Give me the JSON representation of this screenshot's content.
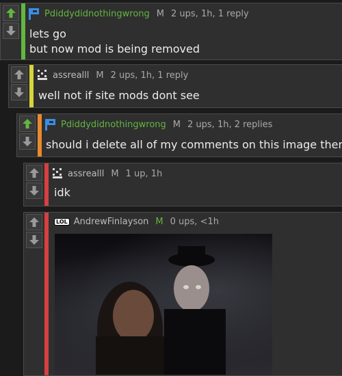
{
  "comments": [
    {
      "user": "Pdiddydidnothingwrong",
      "mod": "M",
      "meta": "2 ups, 1h, 1 reply",
      "lines": [
        "lets go",
        "but now mod is being removed"
      ],
      "bar_color": "#63b63f",
      "upvoted": true
    },
    {
      "user": "assrealll",
      "mod": "M",
      "meta": "2 ups, 1h, 1 reply",
      "lines": [
        "well not if site mods dont see"
      ],
      "bar_color": "#d6d53c",
      "upvoted": false
    },
    {
      "user": "Pdiddydidnothingwrong",
      "mod": "M",
      "meta": "2 ups, 1h, 2 replies",
      "lines": [
        "should i delete all of my comments on this image then"
      ],
      "bar_color": "#e88a2e",
      "upvoted": true
    },
    {
      "user": "assrealll",
      "mod": "M",
      "meta": "1 up, 1h",
      "lines": [
        "idk"
      ],
      "bar_color": "#d64040",
      "upvoted": false
    },
    {
      "user": "AndrewFinlayson",
      "mod": "M",
      "meta": "0 ups, <1h",
      "lines": [],
      "bar_color": "#d64040",
      "upvoted": false,
      "avatar_text": "LOL"
    }
  ],
  "colors": {
    "upvote_active": "#63b63f",
    "vote_inactive": "#9a9a9a"
  },
  "icons": [
    "upvote-arrow-icon",
    "downvote-arrow-icon",
    "flag-avatar-icon",
    "pixel-face-avatar-icon",
    "lol-avatar-icon"
  ]
}
